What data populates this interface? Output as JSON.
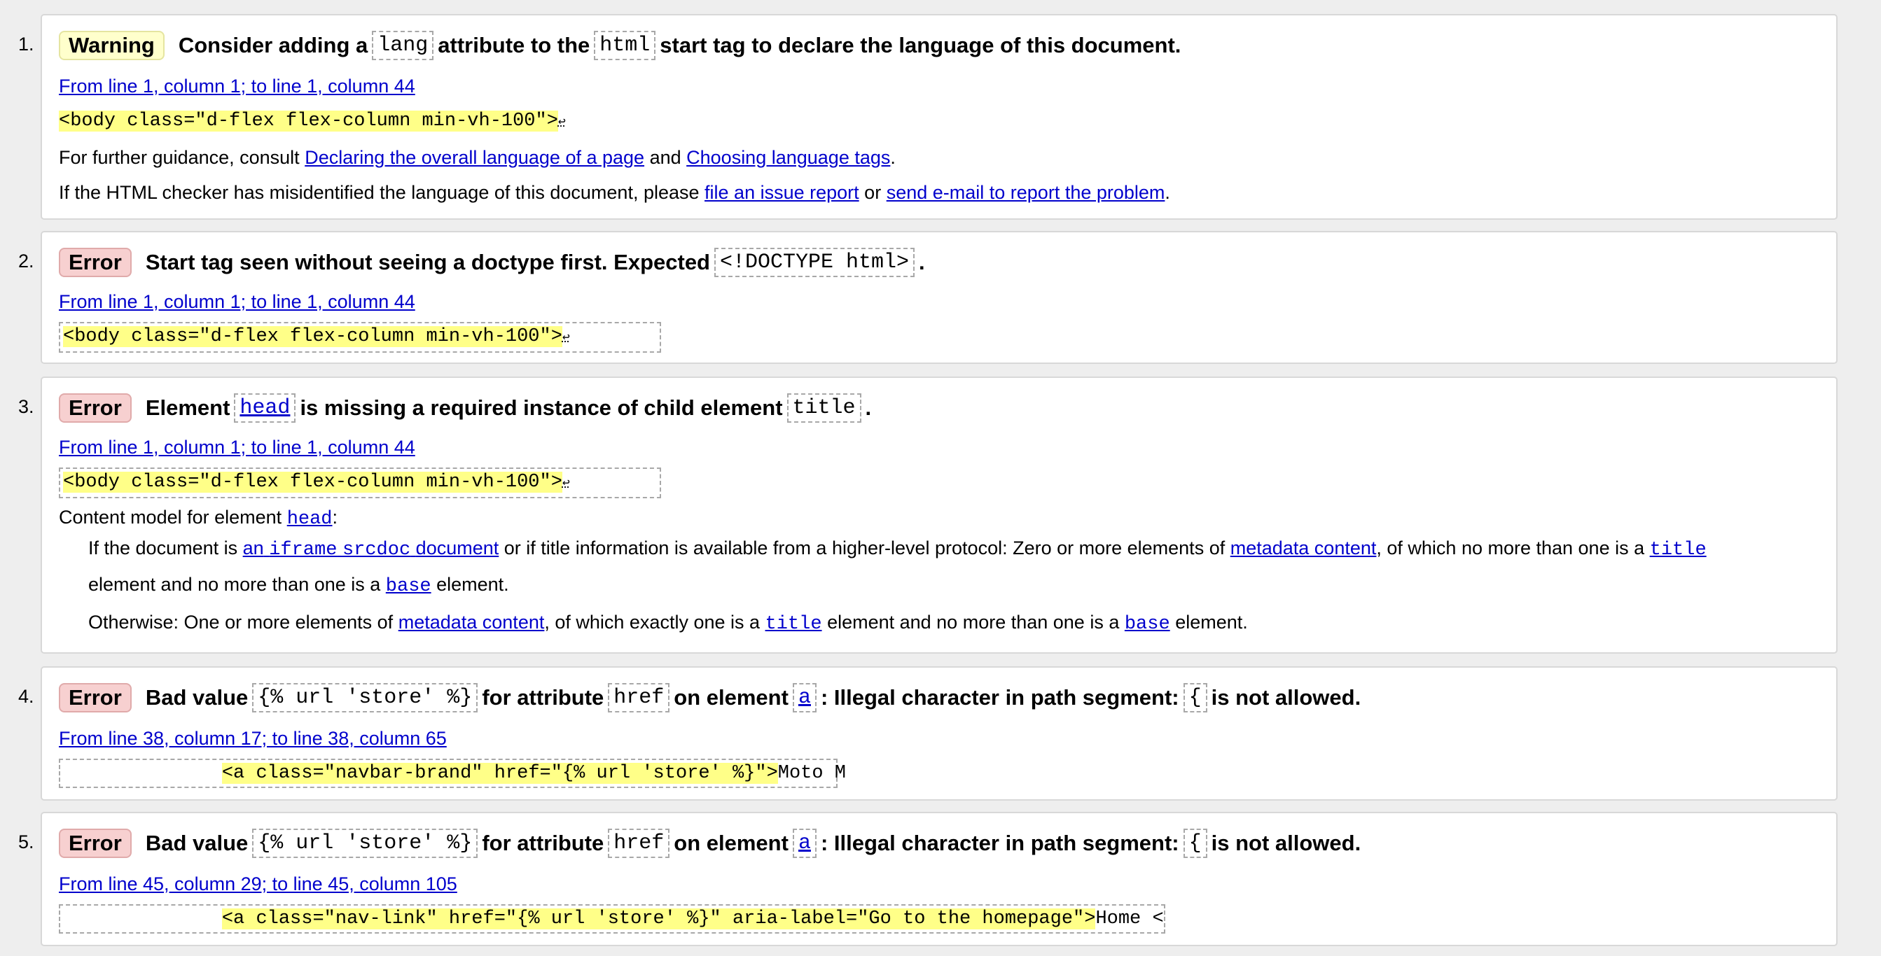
{
  "messages": [
    {
      "num": "1.",
      "type": "Warning",
      "headline": {
        "p1": "Consider adding a",
        "c1": "lang",
        "p2": "attribute to the",
        "c2": "html",
        "p3": "start tag to declare the language of this document."
      },
      "location": "From line 1, column 1; to line 1, column 44",
      "extract": "<body class=\"d-flex flex-column min-vh-100\">",
      "lf": "↩",
      "guidance": {
        "prefix": "For further guidance, consult",
        "link1": "Declaring the overall language of a page",
        "mid": "and",
        "link2": "Choosing language tags",
        "suffix": "."
      },
      "report": {
        "prefix": "If the HTML checker has misidentified the language of this document, please",
        "link1": "file an issue report",
        "mid": "or",
        "link2": "send e-mail to report the problem",
        "suffix": "."
      }
    },
    {
      "num": "2.",
      "type": "Error",
      "headline": {
        "p1": "Start tag seen without seeing a doctype first. Expected",
        "c1": "<!DOCTYPE html>",
        "p2": "."
      },
      "location": "From line 1, column 1; to line 1, column 44",
      "extract": "<body class=\"d-flex flex-column min-vh-100\">",
      "lf": "↩"
    },
    {
      "num": "3.",
      "type": "Error",
      "headline": {
        "p1": "Element",
        "c1": "head",
        "p2": "is missing a required instance of child element",
        "c2": "title",
        "p3": "."
      },
      "location": "From line 1, column 1; to line 1, column 44",
      "extract": "<body class=\"d-flex flex-column min-vh-100\">",
      "lf": "↩",
      "content_model": {
        "prefix": "Content model for element",
        "elem": "head",
        "suffix": ":"
      },
      "cm_line1": {
        "t1": "If the document is",
        "l1a": "an",
        "l1b": "iframe",
        "l1c": "srcdoc",
        "l1d": "document",
        "t2": "or if title information is available from a higher-level protocol: Zero or more elements of",
        "l2": "metadata content",
        "t3": ", of which no more than one is a",
        "l3": "title"
      },
      "cm_line2": {
        "t1": "element and no more than one is a",
        "l1": "base",
        "t2": "element."
      },
      "cm_line3": {
        "t1": "Otherwise: One or more elements of",
        "l1": "metadata content",
        "t2": ", of which exactly one is a",
        "l2": "title",
        "t3": "element and no more than one is a",
        "l3": "base",
        "t4": "element."
      }
    },
    {
      "num": "4.",
      "type": "Error",
      "headline": {
        "p1": "Bad value",
        "c1": "{% url 'store' %}",
        "p2": "for attribute",
        "c2": "href",
        "p3": "on element",
        "c3": "a",
        "p4": ": Illegal character in path segment:",
        "c4": "{",
        "p5": "is not allowed."
      },
      "location": "From line 38, column 17; to line 38, column 65",
      "extract_pre": "              ",
      "extract": "<a class=\"navbar-brand\" href=\"{% url 'store' %}\">",
      "extract_post": "Moto M"
    },
    {
      "num": "5.",
      "type": "Error",
      "headline": {
        "p1": "Bad value",
        "c1": "{% url 'store' %}",
        "p2": "for attribute",
        "c2": "href",
        "p3": "on element",
        "c3": "a",
        "p4": ": Illegal character in path segment:",
        "c4": "{",
        "p5": "is not allowed."
      },
      "location": "From line 45, column 29; to line 45, column 105",
      "extract_pre": "              ",
      "extract": "<a class=\"nav-link\" href=\"{% url 'store' %}\" aria-label=\"Go to the homepage\">",
      "extract_post": "Home <"
    }
  ]
}
